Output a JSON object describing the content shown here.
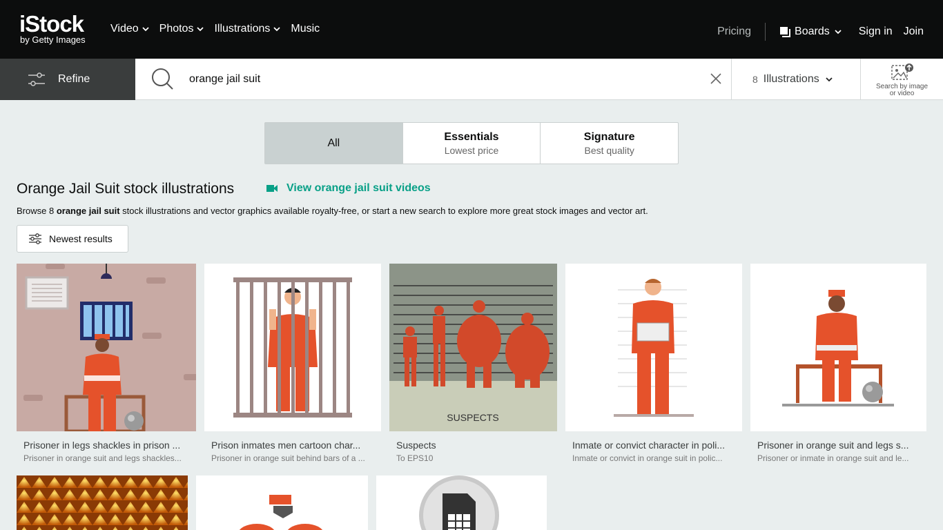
{
  "brand": {
    "logo_main": "iStock",
    "logo_sub": "by Getty Images"
  },
  "nav": {
    "left": [
      {
        "label": "Video",
        "has_menu": true
      },
      {
        "label": "Photos",
        "has_menu": true
      },
      {
        "label": "Illustrations",
        "has_menu": true
      },
      {
        "label": "Music",
        "has_menu": false
      }
    ],
    "pricing": "Pricing",
    "boards": "Boards",
    "signin": "Sign in",
    "join": "Join"
  },
  "search": {
    "refine_label": "Refine",
    "query": "orange jail suit",
    "result_count": "8",
    "type_label": "Illustrations",
    "image_search_label_1": "Search by image",
    "image_search_label_2": "or video"
  },
  "tabs": [
    {
      "title": "All",
      "subtitle": "",
      "active": true
    },
    {
      "title": "Essentials",
      "subtitle": "Lowest price",
      "active": false
    },
    {
      "title": "Signature",
      "subtitle": "Best quality",
      "active": false
    }
  ],
  "heading": "Orange Jail Suit stock illustrations",
  "video_link": "View orange jail suit videos",
  "browse": {
    "prefix": "Browse 8 ",
    "term": "orange jail suit",
    "suffix": " stock illustrations and vector graphics available royalty-free, or start a new search to explore more great stock images and vector art."
  },
  "sort_label": "Newest results",
  "results": [
    {
      "title": "Prisoner in legs shackles in prison ...",
      "subtitle": "Prisoner in orange suit and legs shackles..."
    },
    {
      "title": "Prison inmates men cartoon char...",
      "subtitle": "Prisoner in orange suit behind bars of a ..."
    },
    {
      "title": "Suspects",
      "subtitle": "To EPS10",
      "image_text": "SUSPECTS"
    },
    {
      "title": "Inmate or convict character in poli...",
      "subtitle": "Inmate or convict in orange suit in polic..."
    },
    {
      "title": "Prisoner in orange suit and legs s...",
      "subtitle": "Prisoner or inmate in orange suit and le..."
    }
  ],
  "colors": {
    "topbar": "#0c0d0d",
    "accent_link": "#08a087",
    "suit_orange": "#e5522b",
    "page_bg": "#e9eeee"
  }
}
